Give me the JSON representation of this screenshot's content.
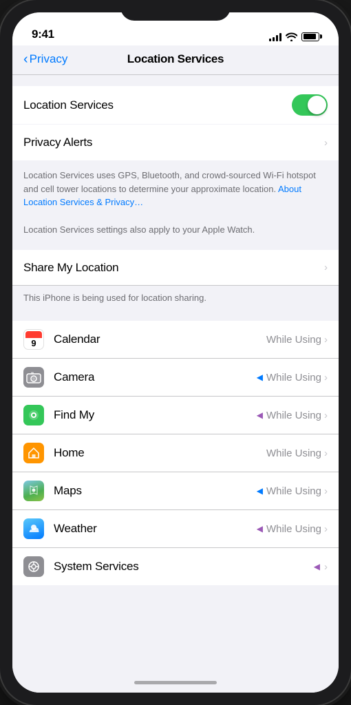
{
  "status": {
    "time": "9:41",
    "signal": [
      3,
      5,
      7,
      9,
      11
    ],
    "wifi": "wifi",
    "battery": 90
  },
  "navigation": {
    "back_label": "Privacy",
    "title": "Location Services"
  },
  "sections": {
    "location_toggle": {
      "label": "Location Services",
      "enabled": true
    },
    "privacy_alerts": {
      "label": "Privacy Alerts"
    },
    "description": {
      "text": "Location Services uses GPS, Bluetooth, and crowd-sourced Wi-Fi hotspot and cell tower locations to determine your approximate location. ",
      "link_text": "About Location Services & Privacy…"
    },
    "note": "Location Services settings also apply to your Apple Watch.",
    "share_my_location": {
      "label": "Share My Location",
      "note": "This iPhone is being used for location sharing."
    },
    "apps": [
      {
        "name": "Calendar",
        "icon_type": "calendar",
        "status": "While Using",
        "arrow": false,
        "arrow_color": ""
      },
      {
        "name": "Camera",
        "icon_type": "camera",
        "status": "While Using",
        "arrow": true,
        "arrow_color": "blue"
      },
      {
        "name": "Find My",
        "icon_type": "findmy",
        "status": "While Using",
        "arrow": true,
        "arrow_color": "purple"
      },
      {
        "name": "Home",
        "icon_type": "home",
        "status": "While Using",
        "arrow": false,
        "arrow_color": ""
      },
      {
        "name": "Maps",
        "icon_type": "maps",
        "status": "While Using",
        "arrow": true,
        "arrow_color": "blue"
      },
      {
        "name": "Weather",
        "icon_type": "weather",
        "status": "While Using",
        "arrow": true,
        "arrow_color": "purple"
      },
      {
        "name": "System Services",
        "icon_type": "system",
        "status": "",
        "arrow": true,
        "arrow_color": "purple"
      }
    ]
  }
}
